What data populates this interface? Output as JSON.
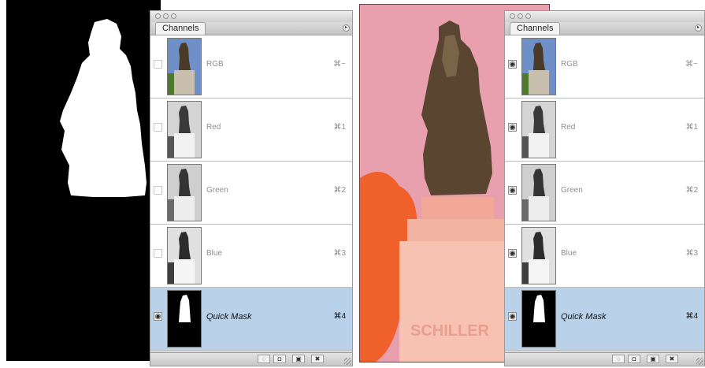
{
  "left_palette": {
    "tab_label": "Channels",
    "menu_icon": "menu-arrow-icon",
    "channels": [
      {
        "name": "RGB",
        "shortcut": "⌘~",
        "visible": false,
        "selected": false
      },
      {
        "name": "Red",
        "shortcut": "⌘1",
        "visible": false,
        "selected": false
      },
      {
        "name": "Green",
        "shortcut": "⌘2",
        "visible": false,
        "selected": false
      },
      {
        "name": "Blue",
        "shortcut": "⌘3",
        "visible": false,
        "selected": false
      },
      {
        "name": "Quick Mask",
        "shortcut": "⌘4",
        "visible": true,
        "selected": true
      }
    ]
  },
  "right_palette": {
    "tab_label": "Channels",
    "menu_icon": "menu-arrow-icon",
    "channels": [
      {
        "name": "RGB",
        "shortcut": "⌘~",
        "visible": true,
        "selected": false
      },
      {
        "name": "Red",
        "shortcut": "⌘1",
        "visible": true,
        "selected": false
      },
      {
        "name": "Green",
        "shortcut": "⌘2",
        "visible": true,
        "selected": false
      },
      {
        "name": "Blue",
        "shortcut": "⌘3",
        "visible": true,
        "selected": false
      },
      {
        "name": "Quick Mask",
        "shortcut": "⌘4",
        "visible": true,
        "selected": true
      }
    ]
  },
  "photo": {
    "pedestal_text": "SCHILLER"
  },
  "colors": {
    "selection": "#b9d2ea",
    "quick_mask_overlay": "#e8a0ae",
    "tree_orange": "#f0602a"
  }
}
